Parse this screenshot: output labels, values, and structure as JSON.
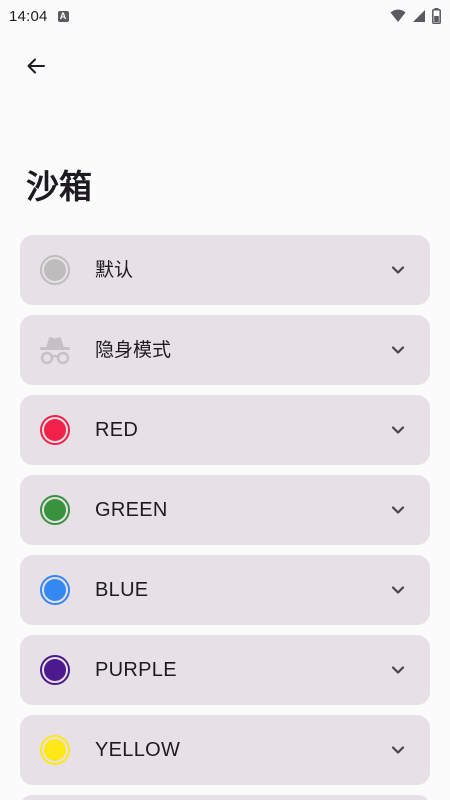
{
  "status_bar": {
    "time": "14:04",
    "notification_letter": "A"
  },
  "page": {
    "title": "沙箱"
  },
  "modes": [
    {
      "label": "默认",
      "icon": "default-circle-icon",
      "color": "#bdbdbd",
      "ring": "#bdbdbd"
    },
    {
      "label": "隐身模式",
      "icon": "incognito-icon",
      "color": "#c4c0c6",
      "ring": "#c4c0c6"
    },
    {
      "label": "RED",
      "icon": "red-color-icon",
      "color": "#f0224a",
      "ring": "#f0224a"
    },
    {
      "label": "GREEN",
      "icon": "green-color-icon",
      "color": "#39933e",
      "ring": "#39933e"
    },
    {
      "label": "BLUE",
      "icon": "blue-color-icon",
      "color": "#3489f0",
      "ring": "#3489f0"
    },
    {
      "label": "PURPLE",
      "icon": "purple-color-icon",
      "color": "#4c1a8c",
      "ring": "#4c1a8c"
    },
    {
      "label": "YELLOW",
      "icon": "yellow-color-icon",
      "color": "#ffe817",
      "ring": "#ffe817"
    }
  ]
}
